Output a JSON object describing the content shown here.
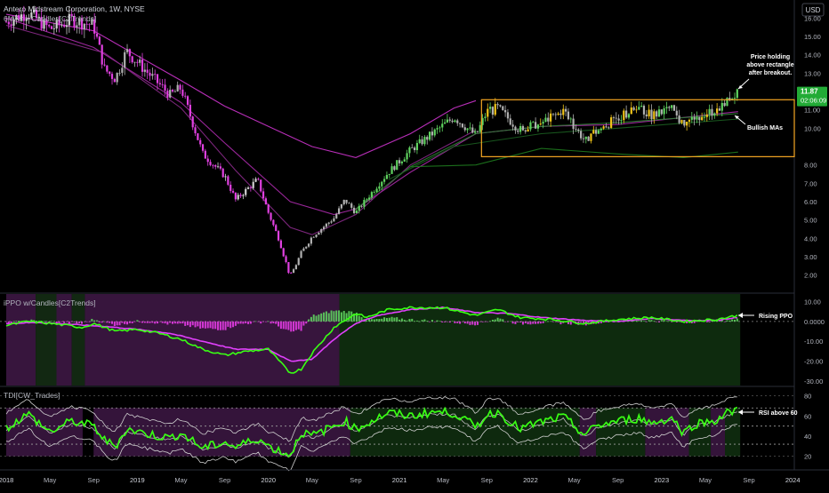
{
  "header": {
    "symbol_title": "Antero Midstream Corporation, 1W, NYSE",
    "ma_study": "6MAs + Candles[C2Trends]",
    "currency": "USD"
  },
  "price_badge": {
    "price": "11.87",
    "countdown": "02:06:09"
  },
  "panels": {
    "ppo_title": "iPPO w/Candles[C2Trends]",
    "tdi_title": "TDI[CW_Trades]"
  },
  "annotations": {
    "price_holding": [
      "Price holding",
      "above rectangle",
      "after breakout."
    ],
    "bullish_mas": "Bullish MAs",
    "rising_ppo": "Rising PPO",
    "rsi_above": "RSI above 60"
  },
  "colors": {
    "background": "#000000",
    "bull": "#5fd35f",
    "bear": "#e63ce6",
    "neutral": "#c8c8c8",
    "rectangle": "#f5a623",
    "ppo_line": "#39ff14",
    "signal_line": "#e040fb",
    "price_badge": "#22ab36"
  },
  "chart_data": [
    {
      "type": "candlestick",
      "title": "Antero Midstream Corporation, 1W, NYSE",
      "x_ticks": [
        "2018",
        "May",
        "Sep",
        "2019",
        "May",
        "Sep",
        "2020",
        "May",
        "Sep",
        "2021",
        "May",
        "Sep",
        "2022",
        "May",
        "Sep",
        "2023",
        "May",
        "Sep",
        "2024"
      ],
      "y_ticks": [
        "2.00",
        "3.00",
        "4.00",
        "5.00",
        "6.00",
        "7.00",
        "8.00",
        "10.00",
        "11.00",
        "13.00",
        "14.00",
        "15.00",
        "16.00"
      ],
      "ylim": [
        1.6,
        16.4
      ],
      "last_price": 11.87,
      "rectangle": {
        "top": 11.55,
        "bottom": 8.45,
        "start": "Sep 2021",
        "end": "2024"
      },
      "close_series": [
        {
          "t": "Jan 2018",
          "v": 15.8
        },
        {
          "t": "Mar 2018",
          "v": 16.3
        },
        {
          "t": "May 2018",
          "v": 15.4
        },
        {
          "t": "Jul 2018",
          "v": 15.9
        },
        {
          "t": "Sep 2018",
          "v": 15.6
        },
        {
          "t": "Oct 2018",
          "v": 13.2
        },
        {
          "t": "Nov 2018",
          "v": 12.7
        },
        {
          "t": "Dec 2018",
          "v": 14.2
        },
        {
          "t": "Feb 2019",
          "v": 13.0
        },
        {
          "t": "Apr 2019",
          "v": 11.8
        },
        {
          "t": "May 2019",
          "v": 12.2
        },
        {
          "t": "Jul 2019",
          "v": 8.6
        },
        {
          "t": "Sep 2019",
          "v": 7.4
        },
        {
          "t": "Oct 2019",
          "v": 6.1
        },
        {
          "t": "Dec 2019",
          "v": 7.2
        },
        {
          "t": "Jan 2020",
          "v": 5.4
        },
        {
          "t": "Feb 2020",
          "v": 3.9
        },
        {
          "t": "Mar 2020",
          "v": 1.9
        },
        {
          "t": "Apr 2020",
          "v": 3.2
        },
        {
          "t": "May 2020",
          "v": 4.1
        },
        {
          "t": "Jul 2020",
          "v": 5.1
        },
        {
          "t": "Aug 2020",
          "v": 6.1
        },
        {
          "t": "Sep 2020",
          "v": 5.4
        },
        {
          "t": "Nov 2020",
          "v": 6.9
        },
        {
          "t": "Dec 2020",
          "v": 7.6
        },
        {
          "t": "Feb 2021",
          "v": 8.8
        },
        {
          "t": "Apr 2021",
          "v": 9.7
        },
        {
          "t": "Jun 2021",
          "v": 10.6
        },
        {
          "t": "Aug 2021",
          "v": 9.6
        },
        {
          "t": "Sep 2021",
          "v": 10.9
        },
        {
          "t": "Oct 2021",
          "v": 11.1
        },
        {
          "t": "Dec 2021",
          "v": 9.9
        },
        {
          "t": "Feb 2022",
          "v": 10.3
        },
        {
          "t": "Apr 2022",
          "v": 10.9
        },
        {
          "t": "Jun 2022",
          "v": 9.3
        },
        {
          "t": "Jul 2022",
          "v": 9.8
        },
        {
          "t": "Sep 2022",
          "v": 10.6
        },
        {
          "t": "Nov 2022",
          "v": 11.1
        },
        {
          "t": "Dec 2022",
          "v": 10.7
        },
        {
          "t": "Feb 2023",
          "v": 11.0
        },
        {
          "t": "Mar 2023",
          "v": 10.1
        },
        {
          "t": "Apr 2023",
          "v": 10.6
        },
        {
          "t": "Jun 2023",
          "v": 11.0
        },
        {
          "t": "Jul 2023",
          "v": 11.6
        },
        {
          "t": "Aug 2023",
          "v": 11.87
        }
      ],
      "moving_averages": [
        {
          "color": "#cc33cc",
          "points": [
            {
              "t": "Jan 2018",
              "v": 16.2
            },
            {
              "t": "Sep 2018",
              "v": 15.3
            },
            {
              "t": "May 2019",
              "v": 12.6
            },
            {
              "t": "Sep 2019",
              "v": 11.2
            },
            {
              "t": "May 2020",
              "v": 9.0
            },
            {
              "t": "Sep 2020",
              "v": 8.4
            },
            {
              "t": "Feb 2021",
              "v": 9.7
            },
            {
              "t": "Jun 2021",
              "v": 11.1
            },
            {
              "t": "Aug 2021",
              "v": 11.5
            }
          ]
        },
        {
          "color": "#aa2aaa",
          "points": [
            {
              "t": "Jan 2018",
              "v": 16.0
            },
            {
              "t": "Sep 2018",
              "v": 14.4
            },
            {
              "t": "May 2019",
              "v": 11.4
            },
            {
              "t": "Sep 2019",
              "v": 9.2
            },
            {
              "t": "Mar 2020",
              "v": 6.0
            },
            {
              "t": "Jul 2020",
              "v": 5.3
            },
            {
              "t": "Sep 2020",
              "v": 5.6
            },
            {
              "t": "Feb 2021",
              "v": 7.6
            },
            {
              "t": "Aug 2021",
              "v": 9.7
            },
            {
              "t": "Feb 2022",
              "v": 10.1
            },
            {
              "t": "Sep 2022",
              "v": 10.2
            },
            {
              "t": "Aug 2023",
              "v": 10.9
            }
          ]
        },
        {
          "color": "#8a2a8a",
          "points": [
            {
              "t": "Jan 2018",
              "v": 15.6
            },
            {
              "t": "Oct 2018",
              "v": 14.1
            },
            {
              "t": "May 2019",
              "v": 11.1
            },
            {
              "t": "Oct 2019",
              "v": 7.7
            },
            {
              "t": "Mar 2020",
              "v": 4.6
            },
            {
              "t": "May 2020",
              "v": 4.2
            },
            {
              "t": "Sep 2020",
              "v": 5.3
            },
            {
              "t": "Feb 2021",
              "v": 8.0
            },
            {
              "t": "Aug 2021",
              "v": 9.9
            }
          ]
        },
        {
          "color": "#2e7d32",
          "points": [
            {
              "t": "Sep 2020",
              "v": 5.6
            },
            {
              "t": "Feb 2021",
              "v": 7.9
            },
            {
              "t": "Aug 2021",
              "v": 9.7
            },
            {
              "t": "Feb 2022",
              "v": 10.1
            },
            {
              "t": "Sep 2022",
              "v": 10.3
            },
            {
              "t": "Aug 2023",
              "v": 10.8
            }
          ]
        },
        {
          "color": "#1b5e20",
          "points": [
            {
              "t": "Dec 2020",
              "v": 7.2
            },
            {
              "t": "Jun 2021",
              "v": 9.0
            },
            {
              "t": "Feb 2022",
              "v": 9.7
            },
            {
              "t": "Sep 2022",
              "v": 10.0
            },
            {
              "t": "Aug 2023",
              "v": 10.5
            }
          ]
        },
        {
          "color": "#1e7a1e",
          "points": [
            {
              "t": "Feb 2021",
              "v": 7.9
            },
            {
              "t": "Aug 2021",
              "v": 8.0
            },
            {
              "t": "Feb 2022",
              "v": 8.9
            },
            {
              "t": "Sep 2022",
              "v": 8.6
            },
            {
              "t": "Mar 2023",
              "v": 8.4
            },
            {
              "t": "Aug 2023",
              "v": 8.7
            }
          ]
        }
      ]
    },
    {
      "type": "line",
      "title": "iPPO w/Candles[C2Trends]",
      "y_ticks": [
        "10.00",
        "0.0000",
        "-10.00",
        "-20.00",
        "-30.00"
      ],
      "ylim": [
        -30,
        12
      ],
      "last_label": "Rising PPO",
      "ppo_series": [
        {
          "t": "Jan 2018",
          "v": -2
        },
        {
          "t": "Mar 2018",
          "v": 0
        },
        {
          "t": "May 2018",
          "v": -1
        },
        {
          "t": "Aug 2018",
          "v": -3
        },
        {
          "t": "Sep 2018",
          "v": -1
        },
        {
          "t": "Nov 2018",
          "v": -5
        },
        {
          "t": "Jan 2019",
          "v": -4
        },
        {
          "t": "Mar 2019",
          "v": -6
        },
        {
          "t": "May 2019",
          "v": -9
        },
        {
          "t": "Jul 2019",
          "v": -14
        },
        {
          "t": "Sep 2019",
          "v": -17
        },
        {
          "t": "Nov 2019",
          "v": -15
        },
        {
          "t": "Jan 2020",
          "v": -14
        },
        {
          "t": "Mar 2020",
          "v": -26
        },
        {
          "t": "Apr 2020",
          "v": -24
        },
        {
          "t": "May 2020",
          "v": -16
        },
        {
          "t": "Jul 2020",
          "v": -3
        },
        {
          "t": "Sep 2020",
          "v": 4
        },
        {
          "t": "Oct 2020",
          "v": 2
        },
        {
          "t": "Dec 2020",
          "v": 6
        },
        {
          "t": "Feb 2021",
          "v": 7
        },
        {
          "t": "May 2021",
          "v": 7
        },
        {
          "t": "Aug 2021",
          "v": 3
        },
        {
          "t": "Oct 2021",
          "v": 6
        },
        {
          "t": "Dec 2021",
          "v": 2
        },
        {
          "t": "Mar 2022",
          "v": 1
        },
        {
          "t": "Jun 2022",
          "v": -1
        },
        {
          "t": "Sep 2022",
          "v": 1
        },
        {
          "t": "Dec 2022",
          "v": 2
        },
        {
          "t": "Mar 2023",
          "v": 0
        },
        {
          "t": "Jun 2023",
          "v": 1
        },
        {
          "t": "Aug 2023",
          "v": 3
        }
      ],
      "signal_series": [
        {
          "t": "Jan 2018",
          "v": -1
        },
        {
          "t": "Apr 2018",
          "v": -0.5
        },
        {
          "t": "Jul 2018",
          "v": -1.5
        },
        {
          "t": "Oct 2018",
          "v": -2.5
        },
        {
          "t": "Jan 2019",
          "v": -4
        },
        {
          "t": "Apr 2019",
          "v": -6
        },
        {
          "t": "Jul 2019",
          "v": -10
        },
        {
          "t": "Oct 2019",
          "v": -14
        },
        {
          "t": "Jan 2020",
          "v": -14
        },
        {
          "t": "Mar 2020",
          "v": -20
        },
        {
          "t": "May 2020",
          "v": -19
        },
        {
          "t": "Jul 2020",
          "v": -9
        },
        {
          "t": "Sep 2020",
          "v": -1
        },
        {
          "t": "Nov 2020",
          "v": 3
        },
        {
          "t": "Feb 2021",
          "v": 6
        },
        {
          "t": "May 2021",
          "v": 7
        },
        {
          "t": "Aug 2021",
          "v": 4.5
        },
        {
          "t": "Nov 2021",
          "v": 4
        },
        {
          "t": "Feb 2022",
          "v": 2
        },
        {
          "t": "Jun 2022",
          "v": 0.5
        },
        {
          "t": "Sep 2022",
          "v": 0
        },
        {
          "t": "Dec 2022",
          "v": 1.5
        },
        {
          "t": "Mar 2023",
          "v": 0.5
        },
        {
          "t": "Jun 2023",
          "v": 0.5
        },
        {
          "t": "Aug 2023",
          "v": 2
        }
      ]
    },
    {
      "type": "line",
      "title": "TDI[CW_Trades]",
      "y_ticks": [
        "80",
        "60",
        "40",
        "20"
      ],
      "ylim": [
        10,
        85
      ],
      "levels": [
        68,
        50,
        32
      ],
      "last_label": "RSI above 60",
      "rsi_series": [
        {
          "t": "Jan 2018",
          "v": 48
        },
        {
          "t": "Mar 2018",
          "v": 62
        },
        {
          "t": "May 2018",
          "v": 44
        },
        {
          "t": "Jul 2018",
          "v": 55
        },
        {
          "t": "Sep 2018",
          "v": 50
        },
        {
          "t": "Oct 2018",
          "v": 36
        },
        {
          "t": "Nov 2018",
          "v": 30
        },
        {
          "t": "Dec 2018",
          "v": 47
        },
        {
          "t": "Feb 2019",
          "v": 42
        },
        {
          "t": "Apr 2019",
          "v": 38
        },
        {
          "t": "May 2019",
          "v": 43
        },
        {
          "t": "Jul 2019",
          "v": 28
        },
        {
          "t": "Sep 2019",
          "v": 34
        },
        {
          "t": "Oct 2019",
          "v": 29
        },
        {
          "t": "Dec 2019",
          "v": 38
        },
        {
          "t": "Jan 2020",
          "v": 30
        },
        {
          "t": "Mar 2020",
          "v": 21
        },
        {
          "t": "Apr 2020",
          "v": 44
        },
        {
          "t": "May 2020",
          "v": 40
        },
        {
          "t": "Jul 2020",
          "v": 50
        },
        {
          "t": "Aug 2020",
          "v": 55
        },
        {
          "t": "Sep 2020",
          "v": 47
        },
        {
          "t": "Nov 2020",
          "v": 58
        },
        {
          "t": "Dec 2020",
          "v": 63
        },
        {
          "t": "Feb 2021",
          "v": 60
        },
        {
          "t": "Apr 2021",
          "v": 64
        },
        {
          "t": "Jun 2021",
          "v": 63
        },
        {
          "t": "Aug 2021",
          "v": 49
        },
        {
          "t": "Sep 2021",
          "v": 61
        },
        {
          "t": "Oct 2021",
          "v": 64
        },
        {
          "t": "Dec 2021",
          "v": 47
        },
        {
          "t": "Feb 2022",
          "v": 54
        },
        {
          "t": "Apr 2022",
          "v": 59
        },
        {
          "t": "Jun 2022",
          "v": 41
        },
        {
          "t": "Jul 2022",
          "v": 50
        },
        {
          "t": "Sep 2022",
          "v": 55
        },
        {
          "t": "Nov 2022",
          "v": 58
        },
        {
          "t": "Dec 2022",
          "v": 53
        },
        {
          "t": "Feb 2023",
          "v": 58
        },
        {
          "t": "Mar 2023",
          "v": 43
        },
        {
          "t": "Apr 2023",
          "v": 52
        },
        {
          "t": "Jun 2023",
          "v": 56
        },
        {
          "t": "Jul 2023",
          "v": 63
        },
        {
          "t": "Aug 2023",
          "v": 66
        }
      ]
    }
  ]
}
